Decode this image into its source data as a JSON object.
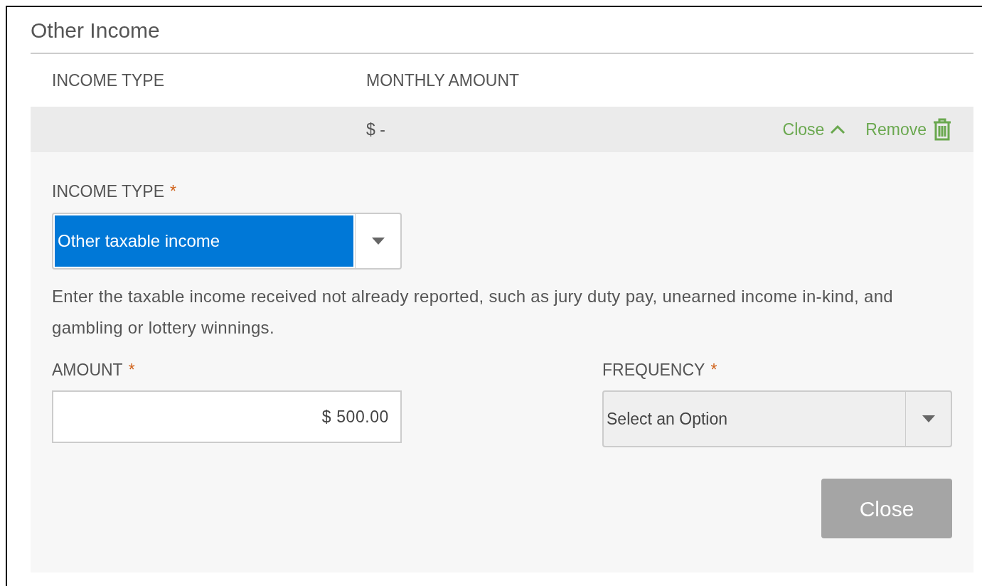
{
  "title": "Other Income",
  "columns": [
    "INCOME TYPE",
    "MONTHLY AMOUNT"
  ],
  "row": {
    "monthly_amount": "$ -",
    "expanded": true,
    "toggle_label": "Close",
    "remove_label": "Remove"
  },
  "form": {
    "income_type": {
      "label": "INCOME TYPE",
      "required_mark": "*",
      "value": "Other taxable income",
      "highlighted": true
    },
    "help": "Enter the taxable income received not already reported, such as jury duty pay, unearned income in-kind, and gambling or lottery winnings.",
    "amount": {
      "label": "AMOUNT",
      "required_mark": "*",
      "value": "$ 500.00"
    },
    "frequency": {
      "label": "FREQUENCY",
      "required_mark": "*",
      "placeholder": "Select an Option"
    },
    "close_button": {
      "label": "Close",
      "disabled": true
    }
  }
}
